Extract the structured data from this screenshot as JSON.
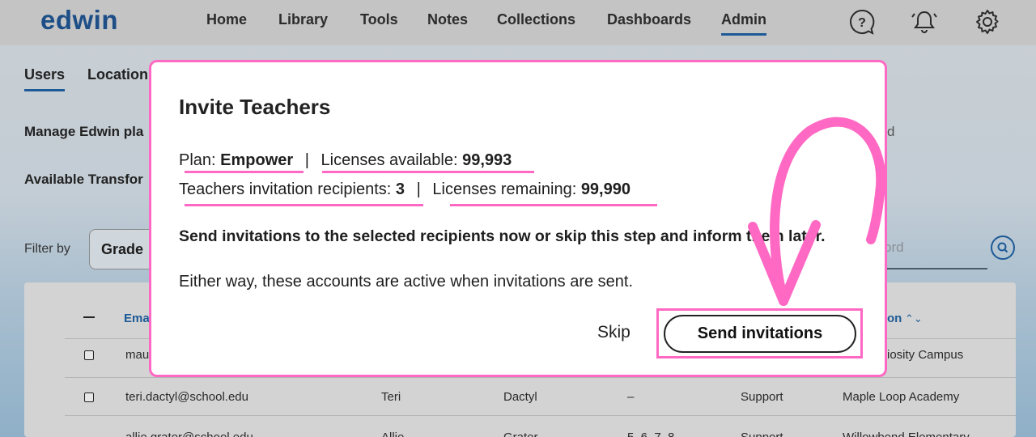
{
  "nav": {
    "logo": "edwin",
    "links": [
      "Home",
      "Library",
      "Tools",
      "Notes",
      "Collections",
      "Dashboards",
      "Admin"
    ],
    "active": "Admin",
    "icons": [
      "help-icon",
      "bell-icon",
      "gear-icon"
    ]
  },
  "subnav": {
    "tabs": [
      "Users",
      "Location"
    ],
    "active": "Users"
  },
  "background": {
    "manage_text": "Manage Edwin pla",
    "right_fragment": "d",
    "available_text": "Available Transfor",
    "filter_label": "Filter by",
    "grade_select": "Grade",
    "search_placeholder_tail": "ord",
    "table": {
      "headers": [
        "Ema",
        "on"
      ],
      "rows": [
        {
          "email": "mau",
          "first": "",
          "last": "",
          "grades": "",
          "role": "",
          "location": "iosity Campus"
        },
        {
          "email": "teri.dactyl@school.edu",
          "first": "Teri",
          "last": "Dactyl",
          "grades": "–",
          "role": "Support",
          "location": "Maple Loop Academy"
        },
        {
          "email": "allie.grater@school.edu",
          "first": "Allie",
          "last": "Grater",
          "grades": "5, 6, 7, 8",
          "role": "Support",
          "location": "Willowbend Elementary"
        }
      ]
    }
  },
  "modal": {
    "title": "Invite Teachers",
    "plan_label": "Plan: ",
    "plan_value": "Empower",
    "sep": "|",
    "licenses_available_label": "Licenses available: ",
    "licenses_available_value": "99,993",
    "recipients_label": "Teachers invitation recipients: ",
    "recipients_value": "3",
    "licenses_remaining_label": "Licenses remaining: ",
    "licenses_remaining_value": "99,990",
    "instruction": "Send invitations to the selected recipients now or skip this step and inform them later.",
    "note": "Either way, these accounts are active when invitations are sent.",
    "skip_label": "Skip",
    "send_label": "Send invitations"
  },
  "colors": {
    "highlight": "#ff69c4",
    "brand": "#1d4e87",
    "link": "#1d5a96"
  }
}
